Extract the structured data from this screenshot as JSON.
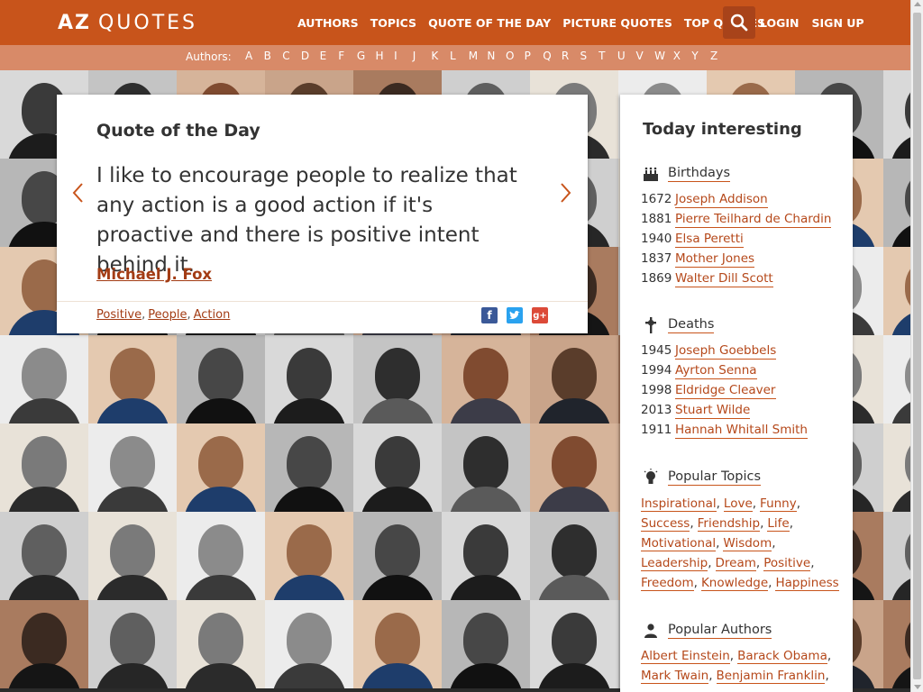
{
  "header": {
    "logo_az": "AZ",
    "logo_quotes": "QUOTES",
    "nav": [
      "AUTHORS",
      "TOPICS",
      "QUOTE OF THE DAY",
      "PICTURE QUOTES",
      "TOP QUOTES"
    ],
    "login": "LOGIN",
    "signup": "SIGN UP",
    "search_icon": "search-icon"
  },
  "letters_bar": {
    "label": "Authors:",
    "letters": [
      "A",
      "B",
      "C",
      "D",
      "E",
      "F",
      "G",
      "H",
      "I",
      "J",
      "K",
      "L",
      "M",
      "N",
      "O",
      "P",
      "Q",
      "R",
      "S",
      "T",
      "U",
      "V",
      "W",
      "X",
      "Y",
      "Z"
    ]
  },
  "quote": {
    "title": "Quote of the Day",
    "text": "I like to encourage people to realize that any action is a good action if it's proactive and there is positive intent behind it.",
    "author": "Michael J. Fox",
    "tags": [
      "Positive",
      "People",
      "Action"
    ],
    "share": [
      "facebook-icon",
      "twitter-icon",
      "google-plus-icon"
    ]
  },
  "sidebar": {
    "title": "Today interesting",
    "birthdays": {
      "title": "Birthdays",
      "items": [
        {
          "year": "1672",
          "name": "Joseph Addison"
        },
        {
          "year": "1881",
          "name": "Pierre Teilhard de Chardin"
        },
        {
          "year": "1940",
          "name": "Elsa Peretti"
        },
        {
          "year": "1837",
          "name": "Mother Jones"
        },
        {
          "year": "1869",
          "name": "Walter Dill Scott"
        }
      ]
    },
    "deaths": {
      "title": "Deaths",
      "items": [
        {
          "year": "1945",
          "name": "Joseph Goebbels"
        },
        {
          "year": "1994",
          "name": "Ayrton Senna"
        },
        {
          "year": "1998",
          "name": "Eldridge Cleaver"
        },
        {
          "year": "2013",
          "name": "Stuart Wilde"
        },
        {
          "year": "1911",
          "name": "Hannah Whitall Smith"
        }
      ]
    },
    "popular_topics": {
      "title": "Popular Topics",
      "items": [
        "Inspirational",
        "Love",
        "Funny",
        "Success",
        "Friendship",
        "Life",
        "Motivational",
        "Wisdom",
        "Leadership",
        "Dream",
        "Positive",
        "Freedom",
        "Knowledge",
        "Happiness"
      ]
    },
    "popular_authors": {
      "title": "Popular Authors",
      "items": [
        "Albert Einstein",
        "Barack Obama",
        "Mark Twain",
        "Benjamin Franklin"
      ]
    }
  },
  "colors": {
    "brand": "#c8541b",
    "link": "#b5481a"
  }
}
